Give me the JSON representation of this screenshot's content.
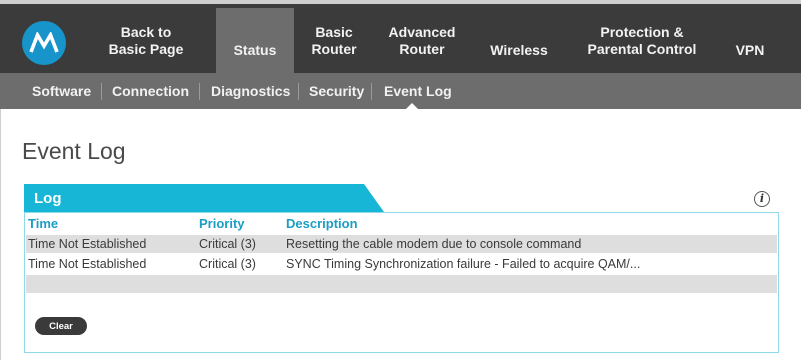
{
  "nav": {
    "items": [
      {
        "label": "Back to\nBasic Page"
      },
      {
        "label": "Status"
      },
      {
        "label": "Basic\nRouter"
      },
      {
        "label": "Advanced\nRouter"
      },
      {
        "label": "Wireless"
      },
      {
        "label": "Protection &\nParental Control"
      },
      {
        "label": "VPN"
      }
    ]
  },
  "subnav": {
    "items": [
      {
        "label": "Software"
      },
      {
        "label": "Connection"
      },
      {
        "label": "Diagnostics"
      },
      {
        "label": "Security"
      },
      {
        "label": "Event Log"
      }
    ]
  },
  "page": {
    "title": "Event Log"
  },
  "log": {
    "tab_label": "Log",
    "info_glyph": "i",
    "columns": [
      "Time",
      "Priority",
      "Description"
    ],
    "rows": [
      {
        "time": "Time Not Established",
        "priority": "Critical (3)",
        "description": "Resetting the cable modem due to console command"
      },
      {
        "time": "Time Not Established",
        "priority": "Critical (3)",
        "description": "SYNC Timing Synchronization failure - Failed to acquire QAM/..."
      }
    ],
    "clear_label": "Clear"
  },
  "colors": {
    "accent": "#17b6d6",
    "header_text": "#1b9ec4",
    "nav_bg": "#3b3b3b",
    "nav_active": "#6d6d6d",
    "logo_bg": "#1794c9"
  },
  "icons": {
    "logo": "motorola-logo-icon",
    "info": "info-icon"
  }
}
